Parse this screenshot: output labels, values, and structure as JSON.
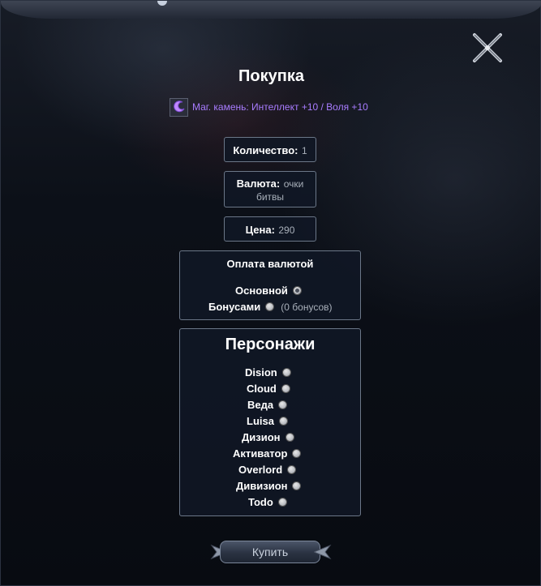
{
  "dialog": {
    "title": "Покупка",
    "item": {
      "name": "Маг. камень: Интеллект +10 / Воля +10",
      "icon": "magic-stone-icon"
    }
  },
  "info": {
    "quantity_label": "Количество:",
    "quantity_value": "1",
    "currency_label": "Валюта:",
    "currency_value_1": "очки",
    "currency_value_2": "битвы",
    "price_label": "Цена:",
    "price_value": "290"
  },
  "payment": {
    "title": "Оплата валютой",
    "options": [
      {
        "label": "Основной",
        "checked": true,
        "note": ""
      },
      {
        "label": "Бонусами",
        "checked": false,
        "note": "(0 бонусов)"
      }
    ]
  },
  "characters": {
    "title": "Персонажи",
    "list": [
      "Dision",
      "Cloud",
      "Веда",
      "Luisa",
      "Дизион",
      "Активатор",
      "Overlord",
      "Дивизион",
      "Todo"
    ]
  },
  "buy_button": {
    "label": "Купить"
  },
  "colors": {
    "item_name": "#a87cff",
    "panel_border": "#6b7788",
    "panel_bg": "#101826"
  }
}
